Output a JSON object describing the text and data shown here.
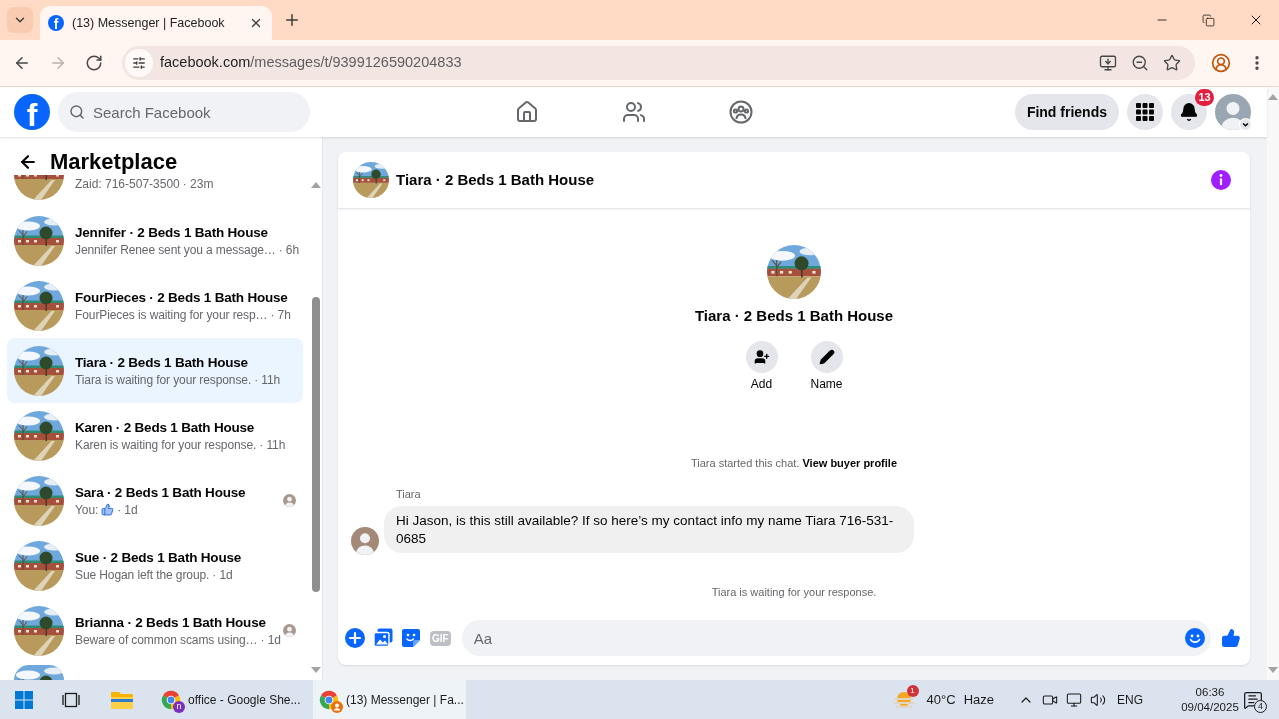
{
  "browser": {
    "tabs": [
      {
        "favicon": "f",
        "title": "(13) Messenger | Facebook",
        "selected": true
      }
    ],
    "nav": [
      {
        "kind": "back",
        "disabled": false
      },
      {
        "kind": "forward",
        "disabled": true
      },
      {
        "kind": "reload",
        "disabled": false
      }
    ],
    "url_host": "facebook.com",
    "url_path": "/messages/t/9399126590204833"
  },
  "header": {
    "logo": "f",
    "search_placeholder": "Search Facebook",
    "nav": [
      {
        "kind": "home",
        "selected": false
      },
      {
        "kind": "friends",
        "selected": false
      },
      {
        "kind": "groups",
        "selected": false
      }
    ],
    "find_friends": "Find friends",
    "notification_count": "13"
  },
  "sidebar": {
    "title": "Marketplace",
    "clipped_row": {
      "preview": "Zaid: 716-507-3500",
      "time": "· 23m"
    },
    "conversations": [
      {
        "title": "Jennifer · 2 Beds 1 Bath House",
        "kind": "text",
        "preview": "Jennifer Renee sent you a message…",
        "time": "· 6h",
        "selected": false,
        "seen": false
      },
      {
        "title": "FourPieces · 2 Beds 1 Bath House",
        "kind": "text",
        "preview": "FourPieces is waiting for your resp…",
        "time": "· 7h",
        "selected": false,
        "seen": false
      },
      {
        "title": "Tiara · 2 Beds 1 Bath House",
        "kind": "text",
        "preview": "Tiara is waiting for your response.",
        "time": "· 11h",
        "selected": true,
        "seen": false
      },
      {
        "title": "Karen · 2 Beds 1 Bath House",
        "kind": "text",
        "preview": "Karen is waiting for your response.",
        "time": "· 11h",
        "selected": false,
        "seen": false
      },
      {
        "title": "Sara · 2 Beds 1 Bath House",
        "kind": "like",
        "preview": "You:",
        "time": "· 1d",
        "selected": false,
        "seen": true
      },
      {
        "title": "Sue · 2 Beds 1 Bath House",
        "kind": "text",
        "preview": "Sue Hogan left the group.",
        "time": "· 1d",
        "selected": false,
        "seen": false
      },
      {
        "title": "Brianna · 2 Beds 1 Bath House",
        "kind": "text",
        "preview": "Beware of common scams using…",
        "time": "· 1d",
        "selected": false,
        "seen": true
      }
    ]
  },
  "chat": {
    "title": "Tiara · 2 Beds 1 Bath House",
    "profile_title": "Tiara · 2 Beds 1 Bath House",
    "actions": [
      {
        "kind": "add",
        "label": "Add"
      },
      {
        "kind": "name",
        "label": "Name"
      }
    ],
    "notice": "Tiara started this chat.",
    "notice_link": "View buyer profile",
    "messages": [
      {
        "sender": "Tiara",
        "text": "Hi Jason, is this still available? If so here’s my contact info my name Tiara 716-531-0685"
      }
    ],
    "status": "Tiara is waiting for your response.",
    "composer": {
      "gif": "GIF",
      "placeholder": "Aa"
    }
  },
  "taskbar": {
    "apps": [
      {
        "label": "office - Google She...",
        "selected": false,
        "badge": {
          "kind": "letter",
          "text": "n",
          "color": "#7b2fbe"
        }
      },
      {
        "label": "(13) Messenger | Fa...",
        "selected": true,
        "badge": {
          "kind": "person",
          "color": "#e8710a"
        }
      }
    ],
    "weather": {
      "badge": "1",
      "temperature": "40°C",
      "condition": "Haze"
    },
    "language": "ENG",
    "time": "06:36",
    "date": "09/04/2025",
    "notification_count": "4"
  }
}
